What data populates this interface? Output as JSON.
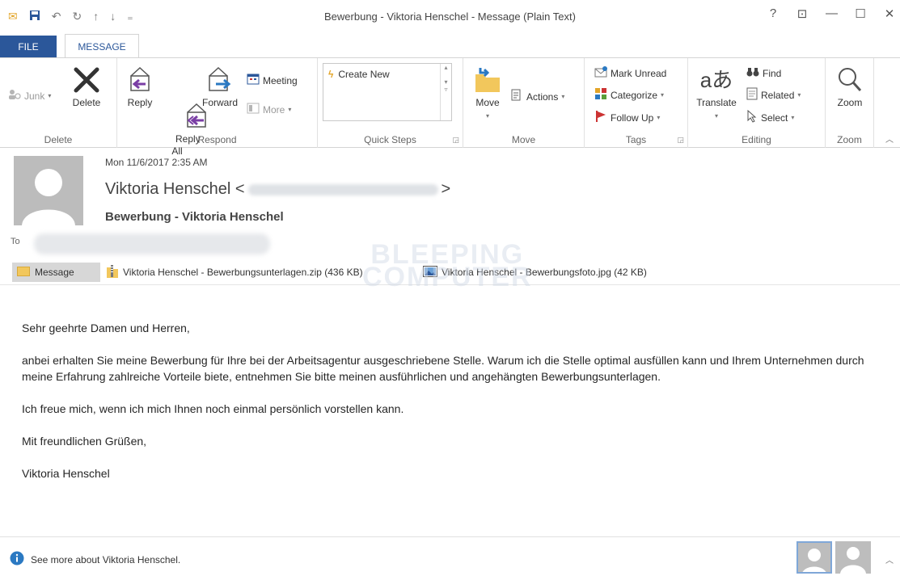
{
  "window": {
    "title": "Bewerbung - Viktoria Henschel - Message (Plain Text)",
    "controls": [
      "?",
      "⊡",
      "—",
      "☐",
      "✕"
    ]
  },
  "quick_access": {
    "icons": [
      "mail-icon",
      "save-icon",
      "undo-icon",
      "redo-icon",
      "up-arrow-icon",
      "down-arrow-icon",
      "customize-icon"
    ]
  },
  "tabs": [
    {
      "label": "FILE",
      "active": false
    },
    {
      "label": "MESSAGE",
      "active": true
    }
  ],
  "ribbon": {
    "delete_group": {
      "label": "Delete",
      "junk": "Junk",
      "delete": "Delete"
    },
    "respond_group": {
      "label": "Respond",
      "reply": "Reply",
      "reply_all": "Reply\nAll",
      "forward": "Forward",
      "meeting": "Meeting",
      "more": "More"
    },
    "quick_steps_group": {
      "label": "Quick Steps",
      "create_new": "Create New"
    },
    "move_group": {
      "label": "Move",
      "move": "Move",
      "actions": "Actions"
    },
    "tags_group": {
      "label": "Tags",
      "mark_unread": "Mark Unread",
      "categorize": "Categorize",
      "follow_up": "Follow Up"
    },
    "editing_group": {
      "label": "Editing",
      "translate": "Translate",
      "find": "Find",
      "related": "Related",
      "select": "Select"
    },
    "zoom_group": {
      "label": "Zoom",
      "zoom": "Zoom"
    }
  },
  "message": {
    "date": "Mon 11/6/2017 2:35 AM",
    "sender_name": "Viktoria Henschel",
    "subject": "Bewerbung - Viktoria Henschel",
    "to_label": "To"
  },
  "attachments": {
    "message_tab": "Message",
    "files": [
      {
        "name": "Viktoria Henschel - Bewerbungsunterlagen.zip (436 KB)",
        "icon": "zip-file-icon"
      },
      {
        "name": "Viktoria Henschel - Bewerbungsfoto.jpg (42 KB)",
        "icon": "image-file-icon"
      }
    ]
  },
  "body": {
    "greeting": "Sehr geehrte Damen und Herren,",
    "paragraph1": "anbei erhalten Sie meine Bewerbung für Ihre bei der Arbeitsagentur ausgeschriebene Stelle. Warum ich die Stelle optimal ausfüllen kann und Ihrem Unternehmen durch meine Erfahrung zahlreiche Vorteile biete, entnehmen Sie bitte meinen ausführlichen und angehängten Bewerbungsunterlagen.",
    "paragraph2": "Ich freue mich, wenn ich mich Ihnen noch einmal persönlich vorstellen kann.",
    "closing": "Mit freundlichen Grüßen,",
    "signature": "Viktoria Henschel"
  },
  "watermark": {
    "line1": "BLEEPING",
    "line2": "COMPUTER"
  },
  "people_pane": {
    "info": "See more about Viktoria Henschel."
  },
  "colors": {
    "accent": "#2b579a",
    "ribbon_border": "#d4d4d4"
  }
}
